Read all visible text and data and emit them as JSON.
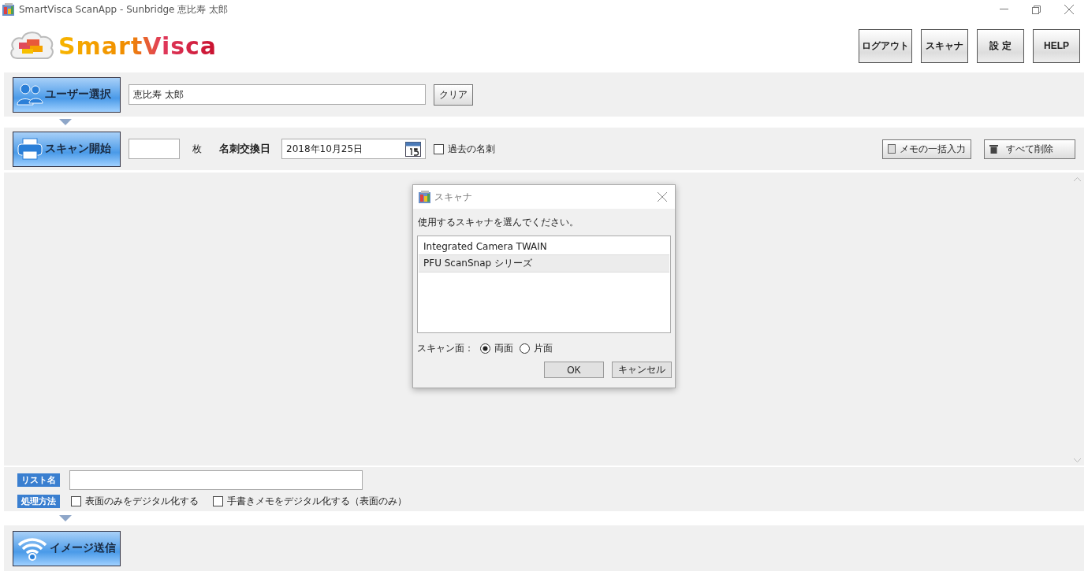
{
  "window": {
    "title": "SmartVisca ScanApp - Sunbridge 恵比寿 太郎"
  },
  "logo": {
    "text": "SmartVisca"
  },
  "header_buttons": [
    "ログアウト",
    "スキャナ",
    "設 定",
    "HELP"
  ],
  "user_row": {
    "button": "ユーザー選択",
    "user_field": {
      "value": "恵比寿 太郎"
    },
    "clear_button": "クリア"
  },
  "scan_row": {
    "button": "スキャン開始",
    "count_unit": "枚",
    "date_label": "名刺交換日",
    "date_field": {
      "value": "2018年10月25日"
    },
    "past_cards": {
      "label": "過去の名刺",
      "checked": false
    },
    "memo_button": "メモの一括入力",
    "delete_all_button": "すべて削除"
  },
  "dialog": {
    "title": "スキャナ",
    "prompt": "使用するスキャナを選んでください。",
    "scanners": [
      {
        "name": "Integrated Camera TWAIN",
        "selected": false
      },
      {
        "name": "PFU ScanSnap シリーズ",
        "selected": true
      }
    ],
    "side_label": "スキャン面：",
    "sides": [
      {
        "label": "両面",
        "selected": true
      },
      {
        "label": "片面",
        "selected": false
      }
    ],
    "buttons": [
      "OK",
      "キャンセル"
    ]
  },
  "bottom": {
    "list_name_label": "リスト名",
    "method_label": "処理方法",
    "options": [
      {
        "label": "表面のみをデジタル化する",
        "checked": false
      },
      {
        "label": "手書きメモをデジタル化する（表面のみ）",
        "checked": false
      }
    ]
  },
  "send_button": "イメージ送信"
}
